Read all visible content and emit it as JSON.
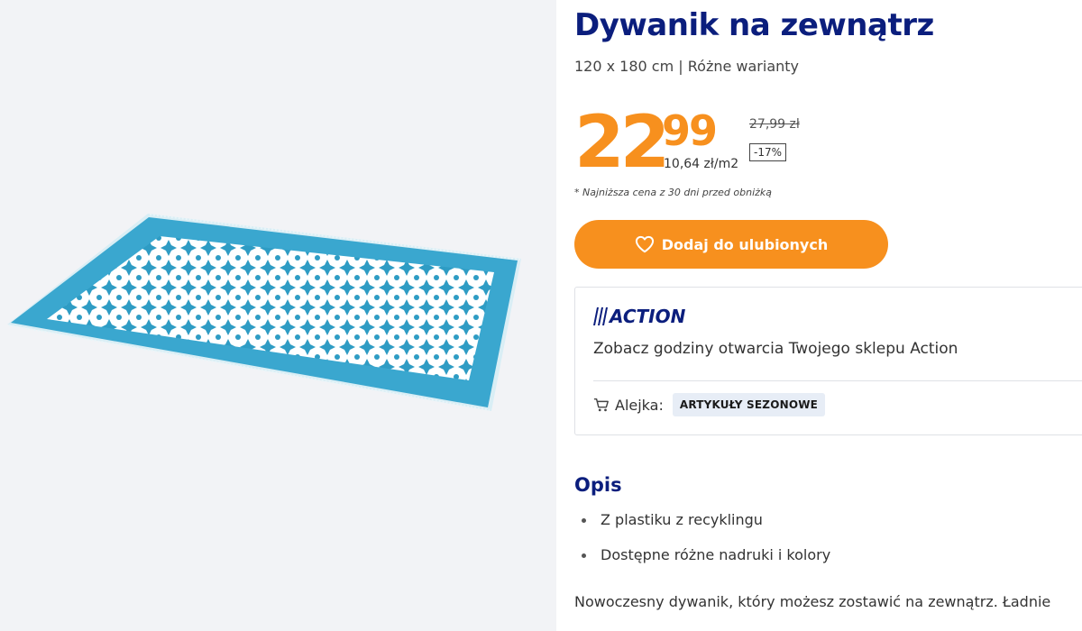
{
  "product": {
    "title": "Dywanik na zewnątrz",
    "subtitle": "120 x 180 cm | Różne warianty",
    "image_alt_icon": "rug-image"
  },
  "price": {
    "whole": "22",
    "cents": "99",
    "unit_price": "10,64 zł/m2",
    "old_price": "27,99 zł",
    "discount": "-17%",
    "footnote": "* Najniższa cena z 30 dni przed obniżką",
    "accent_color": "#f7901e"
  },
  "favorite_button": {
    "label": "Dodaj do ulubionych",
    "icon": "heart-icon"
  },
  "store": {
    "logo_text": "ACTION",
    "hours_link": "Zobacz godziny otwarcia Twojego sklepu Action",
    "aisle_label": "Alejka:",
    "aisle_value": "ARTYKUŁY SEZONOWE",
    "aisle_icon": "cart-icon",
    "brand_color": "#0b1e7d"
  },
  "description": {
    "heading": "Opis",
    "bullets": [
      "Z plastiku z recyklingu",
      "Dostępne różne nadruki i kolory"
    ],
    "text": "Nowoczesny dywanik, który możesz zostawić na zewnątrz. Ładnie"
  }
}
